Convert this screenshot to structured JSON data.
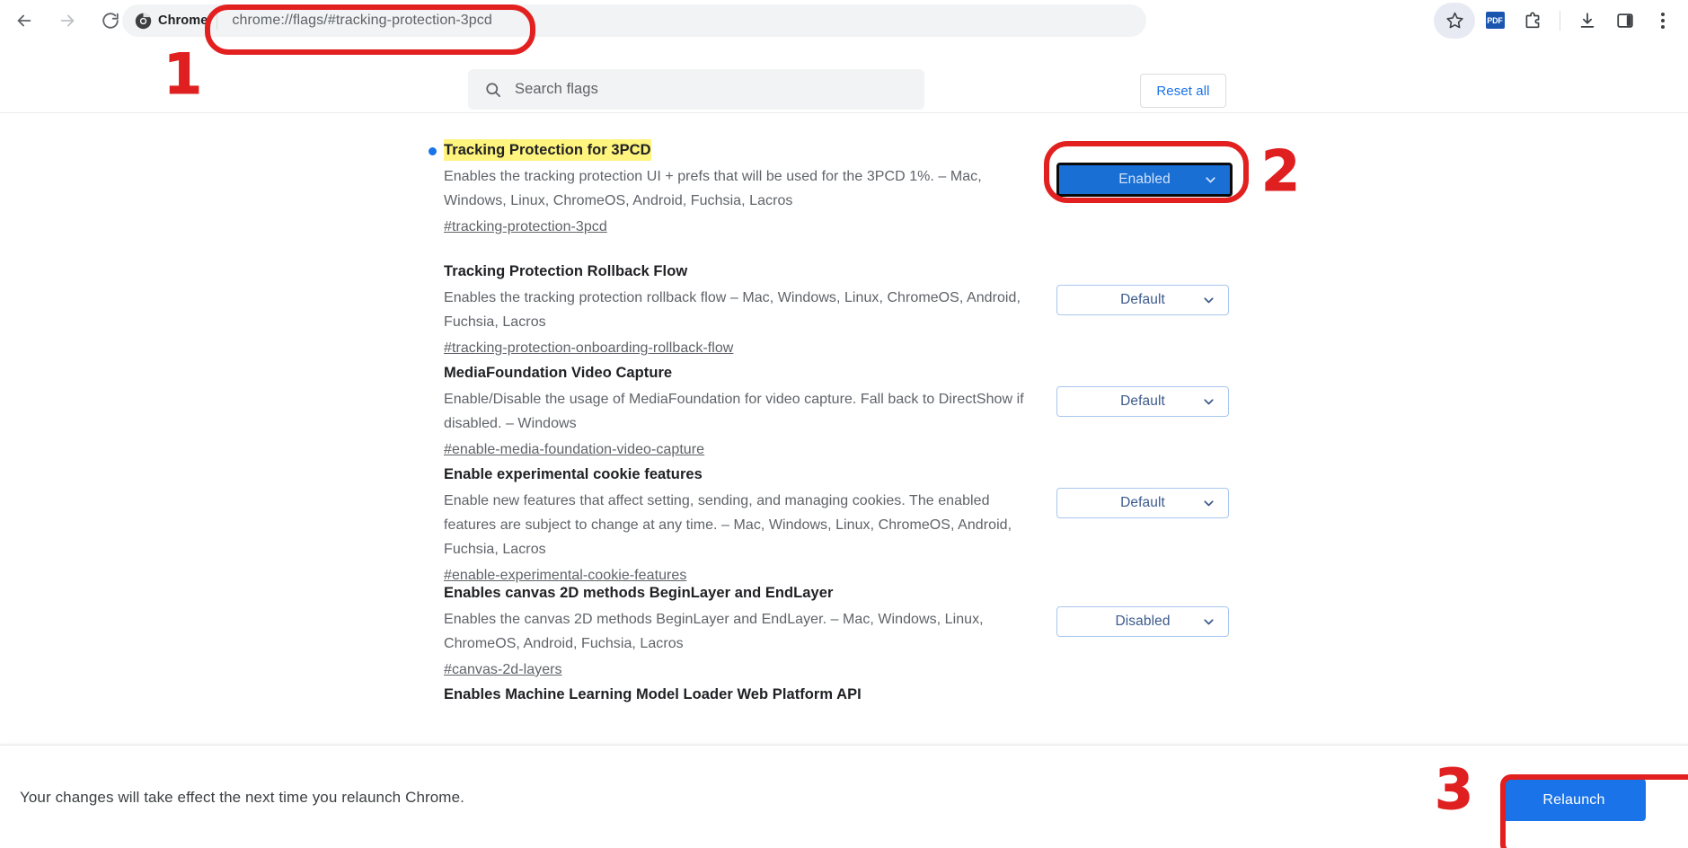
{
  "browser": {
    "back_icon": "arrow-left-icon",
    "forward_icon": "arrow-right-icon",
    "reload_icon": "reload-icon",
    "omnibox": {
      "chip_label": "Chrome",
      "url": "chrome://flags/#tracking-protection-3pcd"
    },
    "right_icons": [
      {
        "name": "bookmark-star-icon",
        "label": ""
      },
      {
        "name": "pdf-icon",
        "label": "PDF"
      },
      {
        "name": "extensions-puzzle-icon",
        "label": ""
      },
      {
        "name": "downloads-icon",
        "label": ""
      },
      {
        "name": "side-panel-icon",
        "label": ""
      },
      {
        "name": "more-menu-icon",
        "label": ""
      }
    ]
  },
  "flags_page": {
    "search": {
      "placeholder": "Search flags",
      "value": ""
    },
    "reset_all_label": "Reset all",
    "flags": [
      {
        "title": "Tracking Protection for 3PCD",
        "highlighted": true,
        "has_blue_dot": true,
        "description": "Enables the tracking protection UI + prefs that will be used for the 3PCD 1%. – Mac, Windows, Linux, ChromeOS, Android, Fuchsia, Lacros",
        "id": "#tracking-protection-3pcd",
        "select_value": "Enabled",
        "select_state": "enabled"
      },
      {
        "title": "Tracking Protection Rollback Flow",
        "highlighted": false,
        "has_blue_dot": false,
        "description": "Enables the tracking protection rollback flow – Mac, Windows, Linux, ChromeOS, Android, Fuchsia, Lacros",
        "id": "#tracking-protection-onboarding-rollback-flow",
        "select_value": "Default",
        "select_state": "default"
      },
      {
        "title": "MediaFoundation Video Capture",
        "highlighted": false,
        "has_blue_dot": false,
        "description": "Enable/Disable the usage of MediaFoundation for video capture. Fall back to DirectShow if disabled. – Windows",
        "id": "#enable-media-foundation-video-capture",
        "select_value": "Default",
        "select_state": "default"
      },
      {
        "title": "Enable experimental cookie features",
        "highlighted": false,
        "has_blue_dot": false,
        "description": "Enable new features that affect setting, sending, and managing cookies. The enabled features are subject to change at any time. – Mac, Windows, Linux, ChromeOS, Android, Fuchsia, Lacros",
        "id": "#enable-experimental-cookie-features",
        "select_value": "Default",
        "select_state": "default"
      },
      {
        "title": "Enables canvas 2D methods BeginLayer and EndLayer",
        "highlighted": false,
        "has_blue_dot": false,
        "description": "Enables the canvas 2D methods BeginLayer and EndLayer. – Mac, Windows, Linux, ChromeOS, Android, Fuchsia, Lacros",
        "id": "#canvas-2d-layers",
        "select_value": "Disabled",
        "select_state": "disabled"
      },
      {
        "title": "Enables Machine Learning Model Loader Web Platform API",
        "highlighted": false,
        "has_blue_dot": false,
        "description": "",
        "id": "",
        "select_value": "",
        "select_state": "none"
      }
    ],
    "select_options": [
      "Default",
      "Enabled",
      "Disabled"
    ]
  },
  "bottom_bar": {
    "message": "Your changes will take effect the next time you relaunch Chrome.",
    "relaunch_label": "Relaunch"
  },
  "annotations": {
    "step1": "1",
    "step2": "2",
    "step3": "3",
    "color": "#e32020"
  }
}
